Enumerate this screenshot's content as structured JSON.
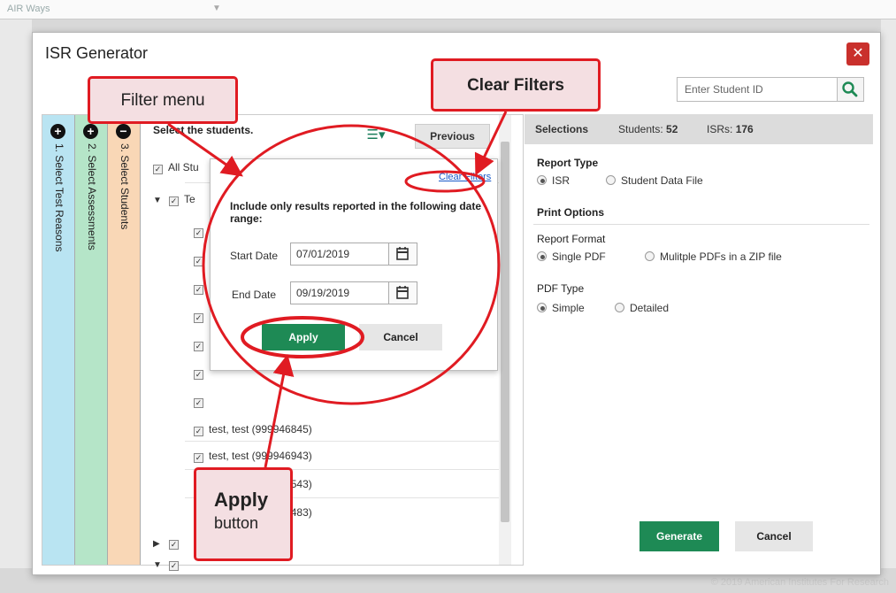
{
  "background": {
    "app_name": "AIR Ways",
    "copyright": "© 2019 American Institutes For Research"
  },
  "modal": {
    "title": "ISR Generator",
    "close_icon": "close-icon",
    "student_id_placeholder": "Enter Student ID"
  },
  "steps": [
    {
      "number": "1.",
      "label": "1. Select Test Reasons"
    },
    {
      "number": "2.",
      "label": "2. Select Assessments"
    },
    {
      "number": "3.",
      "label": "3. Select Students"
    }
  ],
  "student_list": {
    "title": "Select the students.",
    "previous_label": "Previous",
    "all_students": "All Stu",
    "group_partial": "Te",
    "students": [
      "test, test (999946845)",
      "test, test (999946943)",
      "test, test (999946543)",
      "test, test (999946483)"
    ]
  },
  "filter_popover": {
    "clear_filters_label": "Clear Filters",
    "instruction": "Include only results reported in the following date range:",
    "start_label": "Start Date",
    "start_value": "07/01/2019",
    "end_label": "End Date",
    "end_value": "09/19/2019",
    "apply_label": "Apply",
    "cancel_label": "Cancel"
  },
  "selections": {
    "title": "Selections",
    "students_label": "Students:",
    "students_count": "52",
    "isrs_label": "ISRs:",
    "isrs_count": "176",
    "report_type_label": "Report Type",
    "report_type_options": [
      "ISR",
      "Student Data File"
    ],
    "print_options_label": "Print Options",
    "report_format_label": "Report Format",
    "report_format_options": [
      "Single PDF",
      "Mulitple PDFs in a ZIP file"
    ],
    "pdf_type_label": "PDF Type",
    "pdf_type_options": [
      "Simple",
      "Detailed"
    ],
    "generate_label": "Generate",
    "cancel_label": "Cancel"
  },
  "callouts": {
    "filter_menu": "Filter menu",
    "clear_filters": "Clear Filters",
    "apply_title": "Apply",
    "apply_sub": "button"
  },
  "colors": {
    "accent_green": "#1e8a55",
    "callout_red": "#e01b22",
    "callout_fill": "#f4dfe2",
    "close_red": "#c9302c"
  }
}
